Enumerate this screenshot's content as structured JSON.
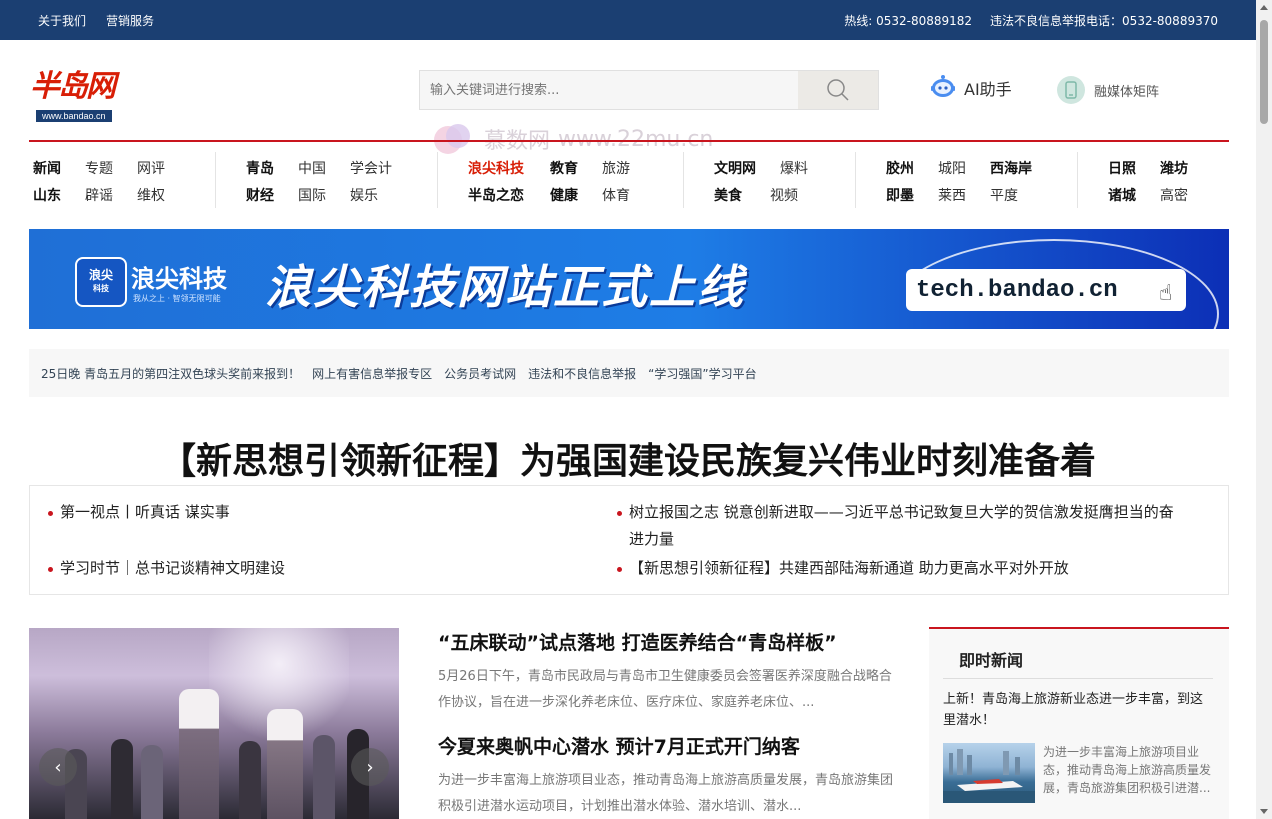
{
  "topbar": {
    "left": [
      "关于我们",
      "营销服务"
    ],
    "hotline": "热线: 0532-80889182",
    "report": "违法不良信息举报电话：0532-80889370"
  },
  "logo": {
    "text": "半岛网",
    "url": "www.bandao.cn"
  },
  "search": {
    "placeholder": "输入关键词进行搜索..."
  },
  "ai": {
    "label": "AI助手"
  },
  "media": {
    "label": "融媒体矩阵"
  },
  "watermark": {
    "cn": "慕数网",
    "url": "www.22mu.cn"
  },
  "nav": {
    "g1": [
      "新闻",
      "专题",
      "网评",
      "山东",
      "辟谣",
      "维权"
    ],
    "g2": [
      "青岛",
      "中国",
      "学会计",
      "财经",
      "国际",
      "娱乐"
    ],
    "g3": [
      "浪尖科技",
      "教育",
      "旅游",
      "半岛之恋",
      "健康",
      "体育"
    ],
    "g4": [
      "文明网",
      "爆料",
      "美食",
      "视频"
    ],
    "g5": [
      "胶州",
      "城阳",
      "西海岸",
      "即墨",
      "莱西",
      "平度"
    ],
    "g6": [
      "日照",
      "潍坊",
      "诸城",
      "高密"
    ]
  },
  "banner": {
    "badge": "浪尖",
    "badge_sub": "科技",
    "brand": "浪尖科技",
    "brand_sub": "我从之上 · 智领无限可能",
    "headline": "浪尖科技网站正式上线",
    "url": "tech.bandao.cn"
  },
  "quick": [
    "25日晚 青岛五月的第四注双色球头奖前来报到！",
    "网上有害信息举报专区",
    "公务员考试网",
    "违法和不良信息举报",
    "“学习强国”学习平台"
  ],
  "lead": {
    "headline": "【新思想引领新征程】为强国建设民族复兴伟业时刻准备着",
    "items": [
      "第一视点丨听真话 谋实事",
      "学习时节｜总书记谈精神文明建设",
      "树立报国之志 锐意创新进取——习近平总书记致复旦大学的贺信激发挺膺担当的奋进力量",
      "【新思想引领新征程】共建西部陆海新通道 助力更高水平对外开放"
    ]
  },
  "slide": {
    "prev": "‹",
    "next": "›"
  },
  "articles": [
    {
      "title": "“五床联动”试点落地 打造医养结合“青岛样板”",
      "desc": "5月26日下午，青岛市民政局与青岛市卫生健康委员会签署医养深度融合战略合作协议，旨在进一步深化养老床位、医疗床位、家庭养老床位、..."
    },
    {
      "title": "今夏来奥帆中心潜水 预计7月正式开门纳客",
      "desc": "为进一步丰富海上旅游项目业态，推动青岛海上旅游高质量发展，青岛旅游集团积极引进潜水运动项目，计划推出潜水体验、潜水培训、潜水..."
    }
  ],
  "sidebar": {
    "title": "即时新闻",
    "top": "上新！青岛海上旅游新业态进一步丰富，到这里潜水！",
    "desc": "为进一步丰富海上旅游项目业态，推动青岛海上旅游高质量发展，青岛旅游集团积极引进潜..."
  },
  "colors": {
    "topbar": "#1b3f72",
    "accent": "#c9151e",
    "logo_red": "#d81e06",
    "banner_blue": "#1e7de6"
  }
}
